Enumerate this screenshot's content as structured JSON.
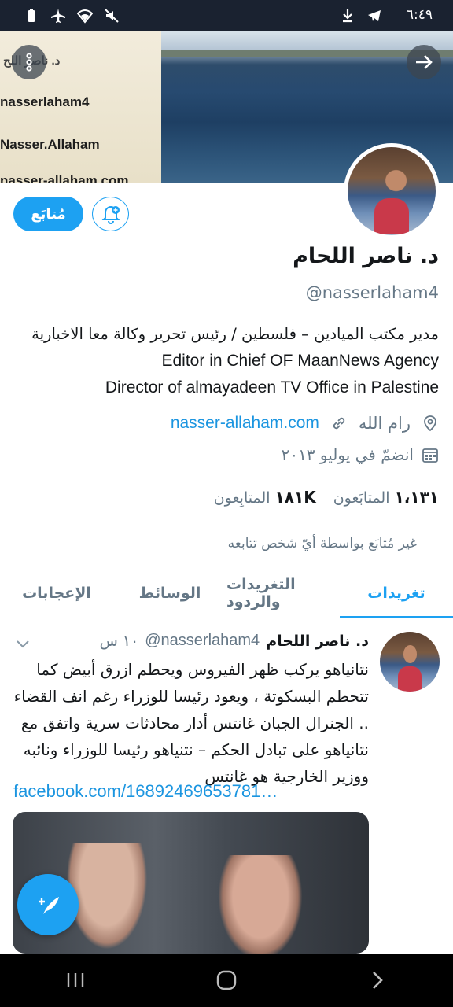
{
  "status_bar": {
    "time": "٦:٤٩"
  },
  "banner": {
    "lines": [
      "د. ناصر اللح",
      "nasserlaham4",
      "Nasser.Allaham",
      "nasser-allaham.com"
    ]
  },
  "profile": {
    "follow_label": "مُتابَع",
    "name": "د. ناصر اللحام",
    "handle": "@nasserlaham4",
    "bio_ar": "مدير مكتب الميادين – فلسطين / رئيس تحرير وكالة معا الاخبارية",
    "bio_en_1": "Editor in Chief OF MaanNews Agency",
    "bio_en_2": "Director of almayadeen TV Office in Palestine",
    "location": "رام الله",
    "website": "nasser-allaham.com",
    "joined": "انضمّ في يوليو ٢٠١٣",
    "following_count": "١،١٣١",
    "following_label": "المتابَعون",
    "followers_count": "١٨١K",
    "followers_label": "المتابِعون",
    "not_followed": "غير مُتابَع بواسطة أيّ شخص تتابعه"
  },
  "tabs": [
    "تغريدات",
    "التغريدات والردود",
    "الوسائط",
    "الإعجابات"
  ],
  "tweet": {
    "name": "د. ناصر اللحام",
    "handle": "@nasserlaham4",
    "time": "١٠ س",
    "text": "نتانياهو يركب ظهر الفيروس ويحطم ازرق أبيض كما تتحطم البسكوتة ، ويعود رئيسا للوزراء رغم انف القضاء .. الجنرال الجبان غانتس أدار محادثات سرية واتفق مع نتانياهو على تبادل الحكم – نتنياهو رئيسا للوزراء ونائبه ووزير الخارجية هو غانتس",
    "link": "facebook.com/16892469653781…"
  },
  "colors": {
    "accent": "#1da1f2",
    "link": "#1b95e0",
    "muted": "#657786"
  },
  "icons": [
    "back-arrow-icon",
    "more-icon",
    "bell-plus-icon",
    "location-icon",
    "link-icon",
    "calendar-icon",
    "chevron-down-icon",
    "compose-icon"
  ]
}
